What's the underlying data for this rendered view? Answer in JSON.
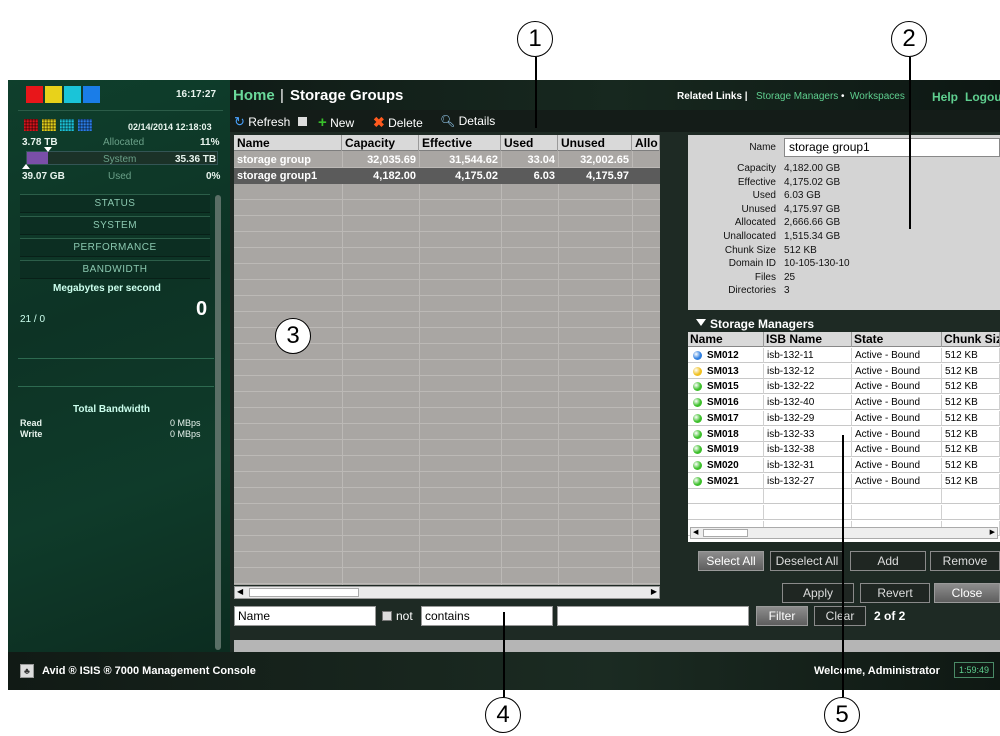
{
  "callouts": [
    "1",
    "2",
    "3",
    "4",
    "5"
  ],
  "left": {
    "clock": "16:17:27",
    "datetime": "02/14/2014 12:18:03",
    "allocated_total": "3.78 TB",
    "allocated_label": "Allocated",
    "allocated_pct": "11%",
    "system_label": "System",
    "system_value": "35.36 TB",
    "used_total": "39.07 GB",
    "used_label": "Used",
    "used_pct": "0%",
    "allocated_fill": 0.11,
    "nav": [
      "STATUS",
      "SYSTEM",
      "PERFORMANCE",
      "BANDWIDTH"
    ],
    "mbps_label": "Megabytes per second",
    "mbps_scale": "21 / 0",
    "mbps_value": "0",
    "total_bw_label": "Total Bandwidth",
    "read_label": "Read",
    "read_value": "0 MBps",
    "write_label": "Write",
    "write_value": "0 MBps"
  },
  "header": {
    "home": "Home",
    "sep": "|",
    "title": "Storage Groups",
    "related_label": "Related Links |",
    "related_links": [
      "Storage Managers",
      "Workspaces"
    ],
    "link_sep": "•",
    "help": "Help",
    "logout": "Logout"
  },
  "toolbar": {
    "refresh": "Refresh",
    "new": "New",
    "delete": "Delete",
    "details": "Details"
  },
  "grid": {
    "columns": [
      "Name",
      "Capacity",
      "Effective",
      "Used",
      "Unused",
      "Allo"
    ],
    "rows": [
      {
        "name": "storage group",
        "capacity": "32,035.69",
        "effective": "31,544.62",
        "used": "33.04",
        "unused": "32,002.65"
      },
      {
        "name": "storage group1",
        "capacity": "4,182.00",
        "effective": "4,175.02",
        "used": "6.03",
        "unused": "4,175.97"
      }
    ]
  },
  "details": {
    "name_label": "Name",
    "name_value": "storage group1",
    "fields": [
      {
        "label": "Capacity",
        "value": "4,182.00 GB"
      },
      {
        "label": "Effective",
        "value": "4,175.02 GB"
      },
      {
        "label": "Used",
        "value": "6.03 GB"
      },
      {
        "label": "Unused",
        "value": "4,175.97 GB"
      },
      {
        "label": "Allocated",
        "value": "2,666.66 GB"
      },
      {
        "label": "Unallocated",
        "value": "1,515.34 GB"
      },
      {
        "label": "Chunk Size",
        "value": "512 KB"
      },
      {
        "label": "Domain ID",
        "value": "10-105-130-10"
      },
      {
        "label": "Files",
        "value": "25"
      },
      {
        "label": "Directories",
        "value": "3"
      }
    ]
  },
  "storage_managers": {
    "title": "Storage Managers",
    "columns": [
      "Name",
      "ISB Name",
      "State",
      "Chunk Siz"
    ],
    "rows": [
      {
        "name": "SM012",
        "isb": "isb-132-11",
        "state": "Active - Bound",
        "chunk": "512 KB",
        "status_color": "#2f7fe0"
      },
      {
        "name": "SM013",
        "isb": "isb-132-12",
        "state": "Active - Bound",
        "chunk": "512 KB",
        "status_color": "#f0c020"
      },
      {
        "name": "SM015",
        "isb": "isb-132-22",
        "state": "Active - Bound",
        "chunk": "512 KB",
        "status_color": "#3cbf2a"
      },
      {
        "name": "SM016",
        "isb": "isb-132-40",
        "state": "Active - Bound",
        "chunk": "512 KB",
        "status_color": "#3cbf2a"
      },
      {
        "name": "SM017",
        "isb": "isb-132-29",
        "state": "Active - Bound",
        "chunk": "512 KB",
        "status_color": "#3cbf2a"
      },
      {
        "name": "SM018",
        "isb": "isb-132-33",
        "state": "Active - Bound",
        "chunk": "512 KB",
        "status_color": "#3cbf2a"
      },
      {
        "name": "SM019",
        "isb": "isb-132-38",
        "state": "Active - Bound",
        "chunk": "512 KB",
        "status_color": "#3cbf2a"
      },
      {
        "name": "SM020",
        "isb": "isb-132-31",
        "state": "Active - Bound",
        "chunk": "512 KB",
        "status_color": "#3cbf2a"
      },
      {
        "name": "SM021",
        "isb": "isb-132-27",
        "state": "Active - Bound",
        "chunk": "512 KB",
        "status_color": "#3cbf2a"
      }
    ],
    "select_all": "Select All",
    "deselect_all": "Deselect All",
    "add": "Add",
    "remove": "Remove"
  },
  "actions": {
    "apply": "Apply",
    "revert": "Revert",
    "close": "Close"
  },
  "filter": {
    "field": "Name",
    "not_label": "not",
    "operator": "contains",
    "value": "",
    "filter_button": "Filter",
    "clear_button": "Clear",
    "count": "2 of 2"
  },
  "status": {
    "product": "Avid ® ISIS ® 7000  Management Console",
    "welcome": "Welcome, Administrator",
    "session_time": "1:59:49"
  },
  "colors": {
    "accent": "#2bb36a",
    "brand_green": "#0f3f2c",
    "link_green": "#5fcf8f"
  }
}
